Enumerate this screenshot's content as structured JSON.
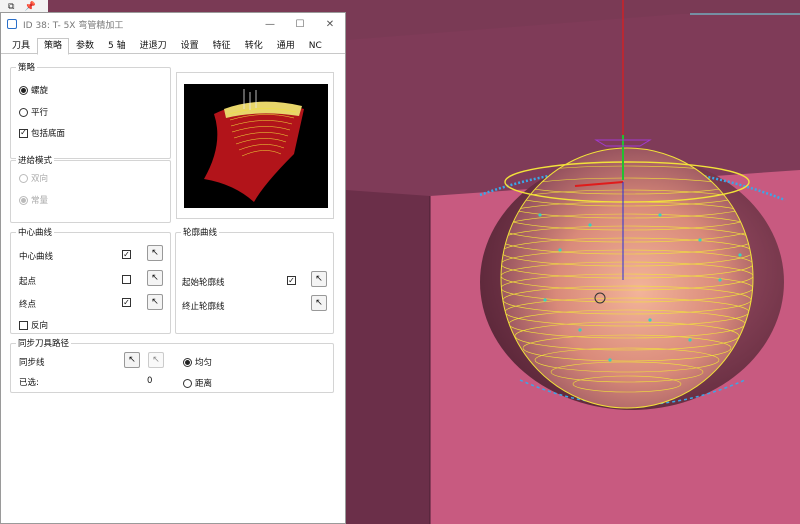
{
  "window": {
    "title": "ID 38: T- 5X 弯管精加工",
    "minimize_icon": "minimize-icon",
    "maximize_icon": "maximize-icon",
    "close_icon": "close-icon"
  },
  "tabs": [
    {
      "label": "刀具",
      "active": false
    },
    {
      "label": "策略",
      "active": true
    },
    {
      "label": "参数",
      "active": false
    },
    {
      "label": "5 轴",
      "active": false
    },
    {
      "label": "进退刀",
      "active": false
    },
    {
      "label": "设置",
      "active": false
    },
    {
      "label": "特征",
      "active": false
    },
    {
      "label": "转化",
      "active": false
    },
    {
      "label": "通用",
      "active": false
    },
    {
      "label": "NC",
      "active": false
    }
  ],
  "strategy": {
    "legend": "策略",
    "spiral_label": "螺旋",
    "parallel_label": "平行",
    "include_bottom_label": "包括底面",
    "spiral_selected": true,
    "include_bottom_checked": true
  },
  "feed_mode": {
    "legend": "进给模式",
    "bidirectional_label": "双向",
    "normal_label": "常量"
  },
  "center_curve": {
    "legend": "中心曲线",
    "center_curve_label": "中心曲线",
    "start_label": "起点",
    "end_label": "终点",
    "reverse_label": "反向",
    "center_checked": true,
    "start_checked": false,
    "end_checked": true,
    "reverse_checked": false
  },
  "contour_curve": {
    "legend": "轮廓曲线",
    "start_contour_label": "起始轮廓线",
    "end_contour_label": "终止轮廓线",
    "start_contour_checked": true
  },
  "sync_path": {
    "legend": "同步刀具路径",
    "sync_line_label": "同步线",
    "selected_label": "已选:",
    "selected_count": "0",
    "uniform_label": "均匀",
    "distance_label": "距离",
    "uniform_selected": true
  },
  "colors": {
    "viewport_wall": "#7a3a55",
    "floor": "#c85a80",
    "toolpath": "#f2e23a",
    "axis_red": "#e01b1b",
    "axis_green": "#22c030",
    "axis_blue": "#2633d8"
  }
}
